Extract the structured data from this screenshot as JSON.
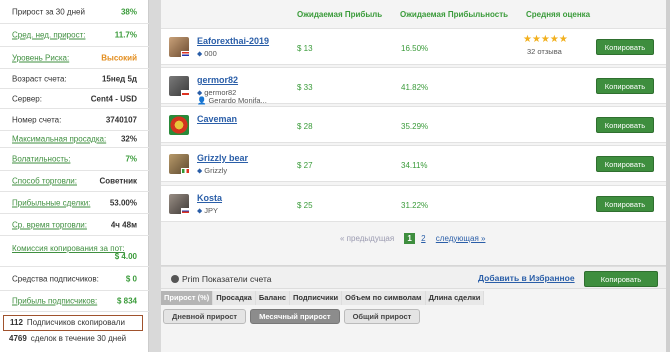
{
  "left_stats": [
    {
      "label": "Прирост за 30 дней",
      "value": "38%",
      "link": false,
      "color": "green"
    },
    {
      "label": "Сред. нед. прирост:",
      "value": "11.7%",
      "link": true,
      "color": "green"
    },
    {
      "label": "Уровень Риска:",
      "value": "Высокий",
      "link": true,
      "color": "orange"
    },
    {
      "label": "Возраст счета:",
      "value": "15нед 5д",
      "link": false,
      "color": "dark"
    },
    {
      "label": "Сервер:",
      "value": "Cent4 - USD",
      "link": false,
      "color": "dark"
    },
    {
      "label": "Номер счета:",
      "value": "3740107",
      "link": false,
      "color": "dark"
    },
    {
      "label": "Максимальная просадка:",
      "value": "32%",
      "link": true,
      "color": "dark"
    },
    {
      "label": "Волатильность:",
      "value": "7%",
      "link": true,
      "color": "green"
    },
    {
      "label": "Способ торговли:",
      "value": "Советник",
      "link": true,
      "color": "dark"
    },
    {
      "label": "Прибыльные сделки:",
      "value": "53.00%",
      "link": true,
      "color": "dark"
    },
    {
      "label": "Ср. время торговли:",
      "value": "4ч 48м",
      "link": true,
      "color": "dark"
    },
    {
      "label": "Комиссия копирования за пот:",
      "value": "$ 4.00",
      "link": true,
      "color": "green"
    },
    {
      "label": "Средства подписчиков:",
      "value": "$ 0",
      "link": false,
      "color": "green"
    },
    {
      "label": "Прибыль подписчиков:",
      "value": "$ 834",
      "link": true,
      "color": "green"
    }
  ],
  "copied": {
    "count": "112",
    "text": "Подписчиков скопировали"
  },
  "deals": {
    "count": "4769",
    "text": "сделок в течение 30 дней"
  },
  "columns": {
    "expected_profit": "Ожидаемая Прибыль",
    "expected_profitability": "Ожидаемая Прибыльность",
    "avg_rating": "Средняя оценка"
  },
  "traders": [
    {
      "name": "Eaforexthai-2019",
      "tag": "000",
      "extra": "",
      "profit": "$ 13",
      "pct": "16.50%",
      "stars": "★★★★★",
      "reviews": "32 отзыва",
      "copy": "Копировать"
    },
    {
      "name": "germor82",
      "tag": "germor82",
      "extra": "Gerardo Monifa...",
      "profit": "$ 33",
      "pct": "41.82%",
      "stars": "",
      "reviews": "",
      "copy": "Копировать"
    },
    {
      "name": "Caveman",
      "tag": "",
      "extra": "",
      "profit": "$ 28",
      "pct": "35.29%",
      "stars": "",
      "reviews": "",
      "copy": "Копировать"
    },
    {
      "name": "Grizzly bear",
      "tag": "Grizzly",
      "extra": "",
      "profit": "$ 27",
      "pct": "34.11%",
      "stars": "",
      "reviews": "",
      "copy": "Копировать"
    },
    {
      "name": "Kosta",
      "tag": "JPY",
      "extra": "",
      "profit": "$ 25",
      "pct": "31.22%",
      "stars": "",
      "reviews": "",
      "copy": "Копировать"
    }
  ],
  "pager": {
    "prev": "« предыдущая",
    "current": "1",
    "page2": "2",
    "next": "следующая »"
  },
  "bottom": {
    "title": "Prim Показатели счета",
    "fav": "Добавить в Избранное",
    "copy": "Копировать",
    "tabs": [
      "Прирост (%)",
      "Просадка",
      "Баланс",
      "Подписчики",
      "Объем по символам",
      "Длина сделки"
    ],
    "subtabs": [
      "Дневной прирост",
      "Месячный прирост",
      "Общий прирост"
    ]
  },
  "colors": {
    "accent_green": "#3e8e3e",
    "link_blue": "#2a5ea8",
    "risk_orange": "#e38d1d"
  }
}
